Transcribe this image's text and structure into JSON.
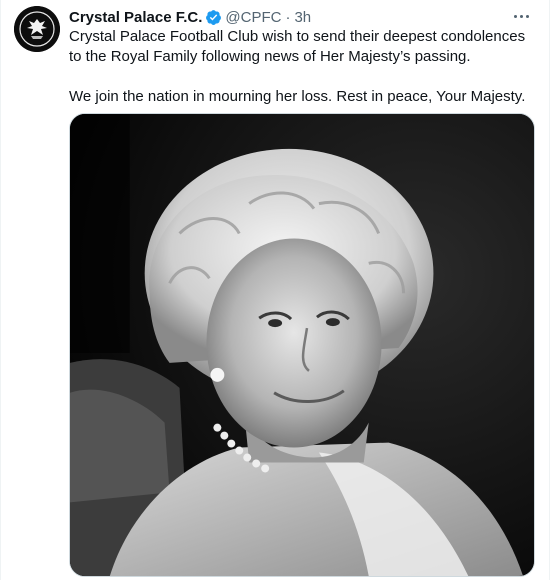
{
  "tweet": {
    "author_name": "Crystal Palace F.C.",
    "handle": "@CPFC",
    "separator": "·",
    "timestamp": "3h",
    "paragraph_1": "Crystal Palace Football Club wish to send their deepest condolences to the Royal Family following news of Her Majesty’s passing.",
    "paragraph_2": "We join the nation in mourning her loss. Rest in peace, Your Majesty.",
    "avatar_icon": "crystal-palace-eagle-crest-icon",
    "verified_icon": "verified-badge-icon",
    "more_icon": "more-options-icon"
  },
  "colors": {
    "text_primary": "#0f1419",
    "text_secondary": "#536471",
    "verified_blue": "#1d9bf0",
    "border": "#cfd9de"
  }
}
